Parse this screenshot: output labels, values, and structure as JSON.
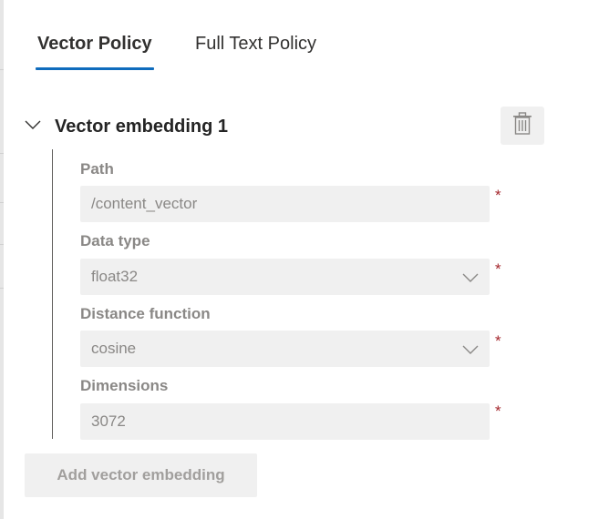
{
  "tabs": [
    {
      "label": "Vector Policy",
      "selected": true
    },
    {
      "label": "Full Text Policy",
      "selected": false
    }
  ],
  "embedding": {
    "title": "Vector embedding 1",
    "expanded": true,
    "fields": {
      "path": {
        "label": "Path",
        "value": "/content_vector",
        "required": "*"
      },
      "data_type": {
        "label": "Data type",
        "value": "float32",
        "required": "*"
      },
      "distance_function": {
        "label": "Distance function",
        "value": "cosine",
        "required": "*"
      },
      "dimensions": {
        "label": "Dimensions",
        "value": "3072",
        "required": "*"
      }
    }
  },
  "add_button_label": "Add vector embedding",
  "icons": {
    "toggle": "chevron-down-icon",
    "delete": "trash-icon",
    "dropdown": "chevron-down-icon"
  },
  "colors": {
    "accent": "#0f6cbd",
    "required": "#a4262c",
    "disabled_text": "#8a8886",
    "field_background": "#f0f0f0"
  }
}
